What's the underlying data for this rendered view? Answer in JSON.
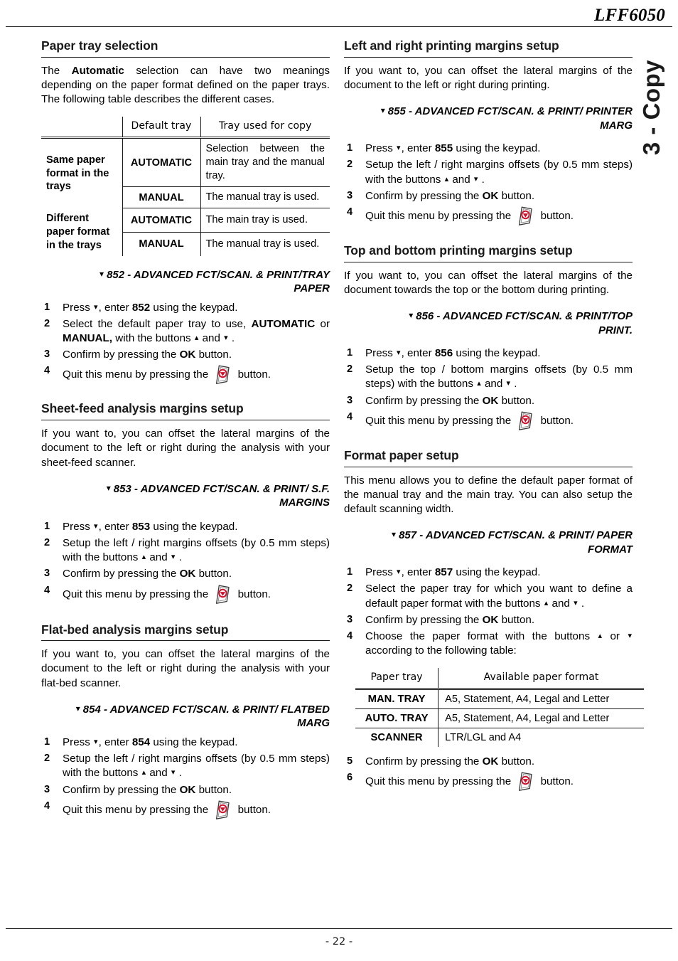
{
  "page": {
    "doc_title": "LFF6050",
    "chapter_tab": "3 - Copy",
    "page_number": "- 22 -"
  },
  "icons": {
    "stop_button": "stop-button-icon",
    "arrow_down": "▾",
    "arrow_up": "▴",
    "menu_bullet": "▾"
  },
  "left_column": {
    "paper_tray_selection": {
      "title": "Paper tray selection",
      "intro_before_bold": "The ",
      "intro_bold": "Automatic",
      "intro_after_bold": " selection can have two meanings depending on the paper format defined on the paper trays. The following table describes the different cases.",
      "table": {
        "headers": [
          "",
          "Default tray",
          "Tray used for copy"
        ],
        "rows": [
          {
            "group": "Same paper format in the trays",
            "entries": [
              {
                "default_tray": "AUTOMATIC",
                "tray_used": "Selection between the main tray and the manual tray."
              },
              {
                "default_tray": "MANUAL",
                "tray_used": "The manual tray is used."
              }
            ]
          },
          {
            "group": "Different paper format in the trays",
            "entries": [
              {
                "default_tray": "AUTOMATIC",
                "tray_used": "The main tray is used."
              },
              {
                "default_tray": "MANUAL",
                "tray_used": "The manual tray is used."
              }
            ]
          }
        ]
      },
      "menu_path": "852 - ADVANCED FCT/SCAN. & PRINT/TRAY PAPER",
      "steps": [
        {
          "num": "1",
          "parts": [
            {
              "t": "Press "
            },
            {
              "icon": "arrow_down"
            },
            {
              "t": ", enter "
            },
            {
              "b": "852"
            },
            {
              "t": " using the keypad."
            }
          ]
        },
        {
          "num": "2",
          "parts": [
            {
              "t": "Select the default paper tray to use, "
            },
            {
              "b": "AUTOMATIC"
            },
            {
              "t": " or "
            },
            {
              "b": "MANUAL,"
            },
            {
              "t": " with the buttons "
            },
            {
              "icon": "arrow_up"
            },
            {
              "t": " and "
            },
            {
              "icon": "arrow_down"
            },
            {
              "t": " ."
            }
          ]
        },
        {
          "num": "3",
          "parts": [
            {
              "t": "Confirm by pressing the "
            },
            {
              "b": "OK"
            },
            {
              "t": " button."
            }
          ]
        },
        {
          "num": "4",
          "parts": [
            {
              "t": "Quit this menu by pressing the "
            },
            {
              "icon": "stop"
            },
            {
              "t": " button."
            }
          ]
        }
      ]
    },
    "sheet_feed": {
      "title": "Sheet-feed analysis margins setup",
      "intro": "If you want to, you can offset the lateral margins of the document to the left or right during the analysis with your sheet-feed scanner.",
      "menu_path": "853 - ADVANCED FCT/SCAN. & PRINT/ S.F. MARGINS",
      "steps": [
        {
          "num": "1",
          "parts": [
            {
              "t": "Press "
            },
            {
              "icon": "arrow_down"
            },
            {
              "t": ", enter "
            },
            {
              "b": "853"
            },
            {
              "t": " using the keypad."
            }
          ]
        },
        {
          "num": "2",
          "parts": [
            {
              "t": "Setup the left / right margins offsets (by 0.5 mm steps) with the buttons "
            },
            {
              "icon": "arrow_up"
            },
            {
              "t": " and "
            },
            {
              "icon": "arrow_down"
            },
            {
              "t": " ."
            }
          ]
        },
        {
          "num": "3",
          "parts": [
            {
              "t": "Confirm by pressing the "
            },
            {
              "b": "OK"
            },
            {
              "t": " button."
            }
          ]
        },
        {
          "num": "4",
          "parts": [
            {
              "t": "Quit this menu by pressing the "
            },
            {
              "icon": "stop"
            },
            {
              "t": " button."
            }
          ]
        }
      ]
    },
    "flat_bed": {
      "title": "Flat-bed analysis margins setup",
      "intro": "If you want to, you can offset the lateral margins of the document to the left or right during the analysis with your flat-bed scanner.",
      "menu_path": "854 - ADVANCED FCT/SCAN. & PRINT/ FLATBED MARG",
      "steps": [
        {
          "num": "1",
          "parts": [
            {
              "t": "Press "
            },
            {
              "icon": "arrow_down"
            },
            {
              "t": ", enter "
            },
            {
              "b": "854"
            },
            {
              "t": " using the keypad."
            }
          ]
        },
        {
          "num": "2",
          "parts": [
            {
              "t": "Setup the left / right margins offsets (by 0.5 mm steps) with the buttons "
            },
            {
              "icon": "arrow_up"
            },
            {
              "t": " and "
            },
            {
              "icon": "arrow_down"
            },
            {
              "t": " ."
            }
          ]
        },
        {
          "num": "3",
          "parts": [
            {
              "t": "Confirm by pressing the "
            },
            {
              "b": "OK"
            },
            {
              "t": " button."
            }
          ]
        },
        {
          "num": "4",
          "parts": [
            {
              "t": "Quit this menu by pressing the "
            },
            {
              "icon": "stop"
            },
            {
              "t": " button."
            }
          ]
        }
      ]
    }
  },
  "right_column": {
    "left_right_margins": {
      "title": "Left and right printing margins setup",
      "intro": "If you want to, you can offset the lateral margins of the document to the left or right during printing.",
      "menu_path": "855 - ADVANCED FCT/SCAN. & PRINT/ PRINTER MARG",
      "steps": [
        {
          "num": "1",
          "parts": [
            {
              "t": "Press "
            },
            {
              "icon": "arrow_down"
            },
            {
              "t": ", enter "
            },
            {
              "b": "855"
            },
            {
              "t": " using the keypad."
            }
          ]
        },
        {
          "num": "2",
          "parts": [
            {
              "t": "Setup the left / right margins offsets (by 0.5 mm steps) with the buttons "
            },
            {
              "icon": "arrow_up"
            },
            {
              "t": " and "
            },
            {
              "icon": "arrow_down"
            },
            {
              "t": " ."
            }
          ]
        },
        {
          "num": "3",
          "parts": [
            {
              "t": "Confirm by pressing the "
            },
            {
              "b": "OK"
            },
            {
              "t": " button."
            }
          ]
        },
        {
          "num": "4",
          "parts": [
            {
              "t": "Quit this menu by pressing the "
            },
            {
              "icon": "stop"
            },
            {
              "t": " button."
            }
          ]
        }
      ]
    },
    "top_bottom_margins": {
      "title": "Top and bottom printing margins setup",
      "intro": "If you want to, you can offset the lateral margins of the document towards the top or the bottom during printing.",
      "menu_path": "856 - ADVANCED FCT/SCAN. & PRINT/TOP PRINT.",
      "steps": [
        {
          "num": "1",
          "parts": [
            {
              "t": "Press "
            },
            {
              "icon": "arrow_down"
            },
            {
              "t": ", enter "
            },
            {
              "b": "856"
            },
            {
              "t": " using the keypad."
            }
          ]
        },
        {
          "num": "2",
          "parts": [
            {
              "t": "Setup the top / bottom margins offsets (by 0.5 mm steps) with the buttons "
            },
            {
              "icon": "arrow_up"
            },
            {
              "t": " and "
            },
            {
              "icon": "arrow_down"
            },
            {
              "t": " ."
            }
          ]
        },
        {
          "num": "3",
          "parts": [
            {
              "t": "Confirm by pressing the "
            },
            {
              "b": "OK"
            },
            {
              "t": " button."
            }
          ]
        },
        {
          "num": "4",
          "parts": [
            {
              "t": "Quit this menu by pressing the "
            },
            {
              "icon": "stop"
            },
            {
              "t": " button."
            }
          ]
        }
      ]
    },
    "format_paper": {
      "title": "Format paper setup",
      "intro": "This menu allows you to define the default paper format of the manual tray and the main tray. You can also setup the default scanning width.",
      "menu_path": "857 - ADVANCED FCT/SCAN. & PRINT/ PAPER FORMAT",
      "steps_before_table": [
        {
          "num": "1",
          "parts": [
            {
              "t": "Press "
            },
            {
              "icon": "arrow_down"
            },
            {
              "t": ", enter "
            },
            {
              "b": "857"
            },
            {
              "t": " using the keypad."
            }
          ]
        },
        {
          "num": "2",
          "parts": [
            {
              "t": "Select the paper tray for which you want to define a default paper format with the buttons "
            },
            {
              "icon": "arrow_up"
            },
            {
              "t": " and "
            },
            {
              "icon": "arrow_down"
            },
            {
              "t": " ."
            }
          ]
        },
        {
          "num": "3",
          "parts": [
            {
              "t": "Confirm by pressing the "
            },
            {
              "b": "OK"
            },
            {
              "t": " button."
            }
          ]
        },
        {
          "num": "4",
          "parts": [
            {
              "t": "Choose the paper format with the buttons "
            },
            {
              "icon": "arrow_up"
            },
            {
              "t": " or "
            },
            {
              "icon": "arrow_down"
            },
            {
              "t": " according to the following table:"
            }
          ]
        }
      ],
      "table": {
        "headers": [
          "Paper tray",
          "Available paper format"
        ],
        "rows": [
          {
            "tray": "MAN. TRAY",
            "formats": "A5, Statement, A4, Legal and Letter"
          },
          {
            "tray": "AUTO. TRAY",
            "formats": "A5, Statement, A4, Legal and Letter"
          },
          {
            "tray": "SCANNER",
            "formats": "LTR/LGL and A4"
          }
        ]
      },
      "steps_after_table": [
        {
          "num": "5",
          "parts": [
            {
              "t": "Confirm by pressing the "
            },
            {
              "b": "OK"
            },
            {
              "t": " button."
            }
          ]
        },
        {
          "num": "6",
          "parts": [
            {
              "t": "Quit this menu by pressing the "
            },
            {
              "icon": "stop"
            },
            {
              "t": " button."
            }
          ]
        }
      ]
    }
  }
}
